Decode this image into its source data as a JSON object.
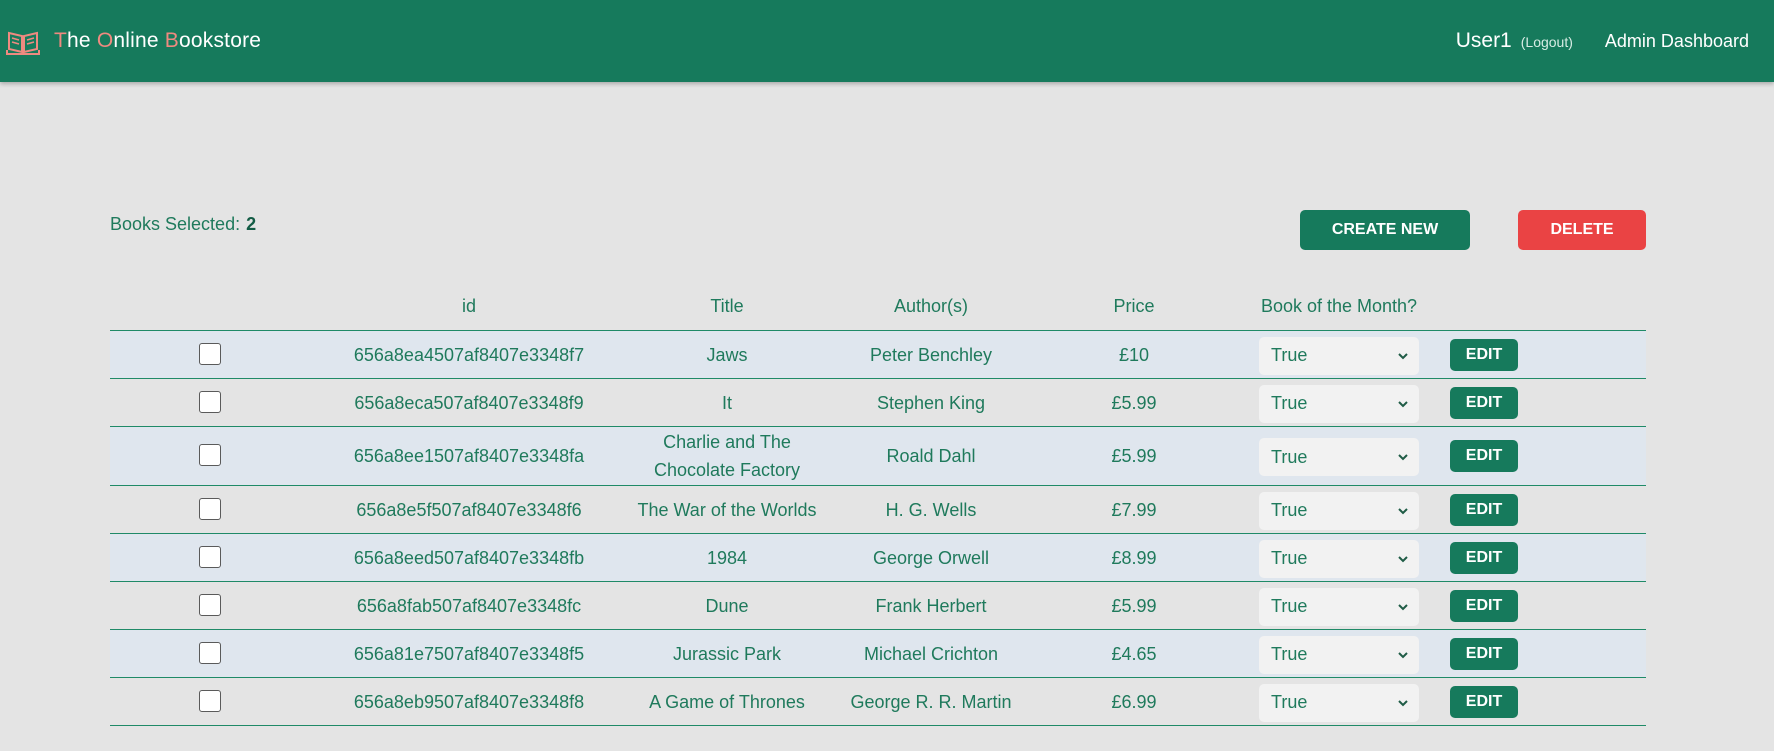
{
  "navbar": {
    "brand": {
      "letter1": "T",
      "rest1": "he ",
      "letter2": "O",
      "rest2": "nline ",
      "letter3": "B",
      "rest3": "ookstore"
    },
    "user": "User1",
    "logout": "(Logout)",
    "admin": "Admin Dashboard"
  },
  "colors": {
    "navbar": "#167a5c",
    "accent": "#ef8a80",
    "primary": "#167a5c",
    "danger": "#ea4344",
    "text": "#1f7a5c"
  },
  "selection": {
    "label": "Books Selected:",
    "count": "2"
  },
  "actions": {
    "create": "CREATE NEW",
    "delete": "DELETE"
  },
  "table": {
    "headers": {
      "id": "id",
      "title": "Title",
      "authors": "Author(s)",
      "price": "Price",
      "botm": "Book of the Month?"
    },
    "edit_label": "EDIT",
    "rows": [
      {
        "id": "656a8ea4507af8407e3348f7",
        "title": "Jaws",
        "title2": "",
        "author": "Peter Benchley",
        "price": "£10",
        "botm": "True"
      },
      {
        "id": "656a8eca507af8407e3348f9",
        "title": "It",
        "title2": "",
        "author": "Stephen King",
        "price": "£5.99",
        "botm": "True"
      },
      {
        "id": "656a8ee1507af8407e3348fa",
        "title": "Charlie and The",
        "title2": "Chocolate Factory",
        "author": "Roald Dahl",
        "price": "£5.99",
        "botm": "True"
      },
      {
        "id": "656a8e5f507af8407e3348f6",
        "title": "The War of the Worlds",
        "title2": "",
        "author": "H. G. Wells",
        "price": "£7.99",
        "botm": "True"
      },
      {
        "id": "656a8eed507af8407e3348fb",
        "title": "1984",
        "title2": "",
        "author": "George Orwell",
        "price": "£8.99",
        "botm": "True"
      },
      {
        "id": "656a8fab507af8407e3348fc",
        "title": "Dune",
        "title2": "",
        "author": "Frank Herbert",
        "price": "£5.99",
        "botm": "True"
      },
      {
        "id": "656a81e7507af8407e3348f5",
        "title": "Jurassic Park",
        "title2": "",
        "author": "Michael Crichton",
        "price": "£4.65",
        "botm": "True"
      },
      {
        "id": "656a8eb9507af8407e3348f8",
        "title": "A Game of Thrones",
        "title2": "",
        "author": "George R. R. Martin",
        "price": "£6.99",
        "botm": "True"
      }
    ]
  }
}
